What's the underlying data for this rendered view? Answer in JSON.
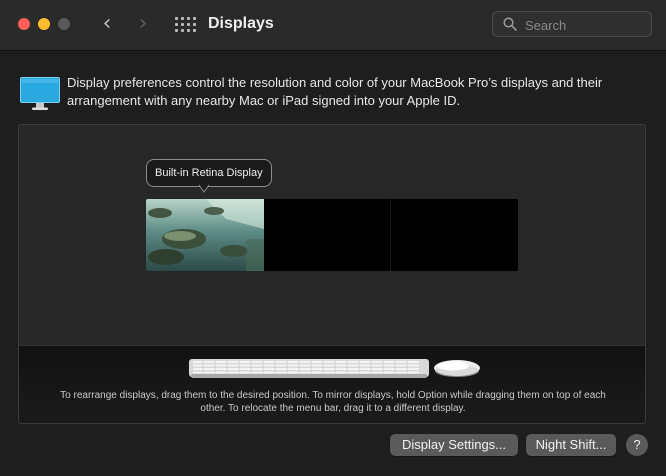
{
  "window": {
    "title": "Displays",
    "search_placeholder": "Search"
  },
  "toolbar": {
    "back_glyph": "‹",
    "forward_glyph": "›"
  },
  "info": {
    "text": "Display preferences control the resolution and color of your MacBook Pro’s displays and their arrangement with any nearby Mac or iPad signed into your Apple ID."
  },
  "arrangement": {
    "tooltip": "Built-in Retina Display",
    "help_text": "To rearrange displays, drag them to the desired position. To mirror displays, hold Option while dragging them on top of each other. To relocate the menu bar, drag it to a different display."
  },
  "buttons": {
    "display_settings": "Display Settings...",
    "night_shift": "Night Shift...",
    "help": "?"
  },
  "icons": {
    "close": "close-icon",
    "minimize": "minimize-icon",
    "zoom": "zoom-icon",
    "grid": "grid-icon",
    "search": "search-icon",
    "display": "display-icon",
    "keyboard": "keyboard-icon",
    "mouse": "mouse-icon"
  },
  "colors": {
    "close": "#ff5f57",
    "minimize": "#febc2e",
    "zoom_inactive": "#5a5a5a",
    "accent_display": "#2aa8e0"
  }
}
